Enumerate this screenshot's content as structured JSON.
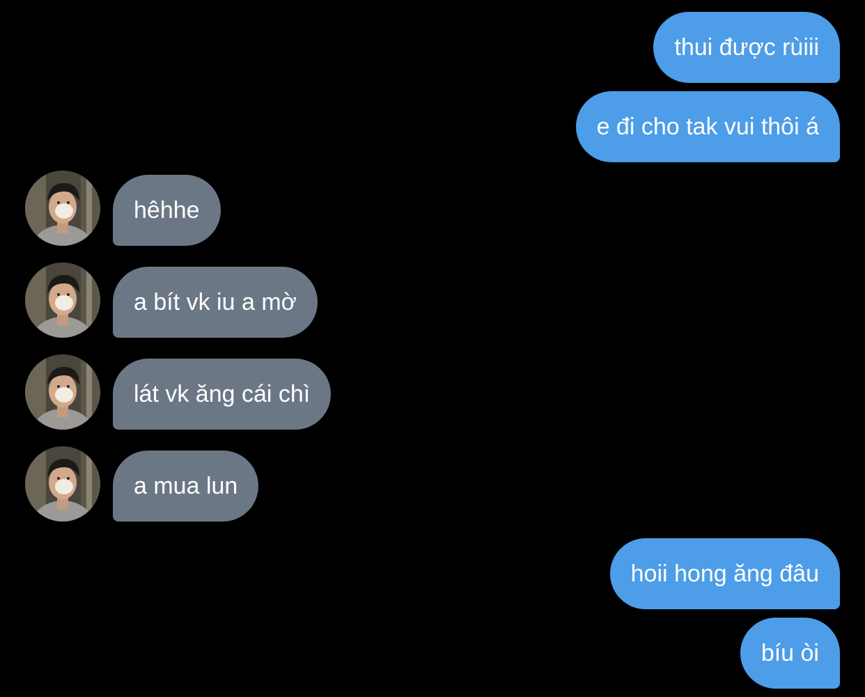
{
  "messages": [
    {
      "direction": "outgoing",
      "text": "thui được rùiii"
    },
    {
      "direction": "outgoing",
      "text": "e đi cho tak vui thôi á"
    },
    {
      "direction": "incoming",
      "text": "hêhhe"
    },
    {
      "direction": "incoming",
      "text": "a bít vk iu a mờ"
    },
    {
      "direction": "incoming",
      "text": "lát vk ăng cái chì"
    },
    {
      "direction": "incoming",
      "text": "a mua lun"
    },
    {
      "direction": "outgoing",
      "text": "hoii hong ăng đâu"
    },
    {
      "direction": "outgoing",
      "text": "bíu òi"
    }
  ],
  "contact": {
    "avatar_icon": "contact-avatar-photo"
  },
  "colors": {
    "background": "#000000",
    "outgoing_bubble": "#4d9de8",
    "incoming_bubble": "#6c7786",
    "text": "#ffffff"
  }
}
